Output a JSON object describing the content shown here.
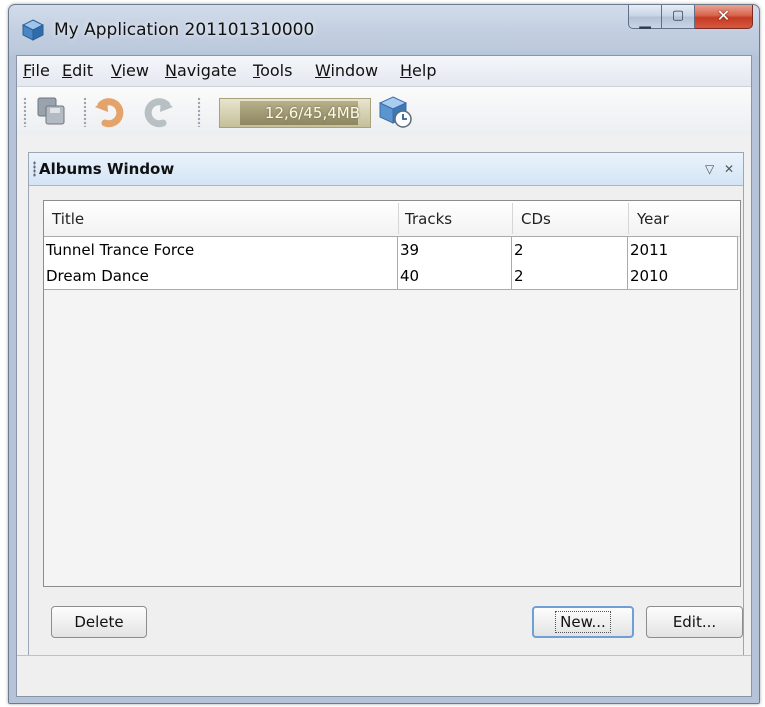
{
  "window": {
    "title": "My Application 201101310000"
  },
  "menu": [
    {
      "mnemonic": "F",
      "rest": "ile"
    },
    {
      "mnemonic": "E",
      "rest": "dit"
    },
    {
      "mnemonic": "V",
      "rest": "iew"
    },
    {
      "mnemonic": "N",
      "rest": "avigate"
    },
    {
      "mnemonic": "T",
      "rest": "ools"
    },
    {
      "mnemonic": "W",
      "rest": "indow"
    },
    {
      "mnemonic": "H",
      "rest": "elp"
    }
  ],
  "toolbar": {
    "memory_label": "12,6/45,4MB",
    "memory_used_fraction": 0.28,
    "icons": [
      "save-all-icon",
      "undo-icon",
      "redo-icon",
      "garbage-collect-icon"
    ]
  },
  "albums_panel": {
    "title": "Albums Window",
    "table": {
      "columns": [
        "Title",
        "Tracks",
        "CDs",
        "Year"
      ],
      "rows": [
        [
          "Tunnel Trance Force",
          "39",
          "2",
          "2011"
        ],
        [
          "Dream Dance",
          "40",
          "2",
          "2010"
        ]
      ]
    },
    "buttons": {
      "delete": "Delete",
      "new": "New...",
      "edit": "Edit..."
    }
  },
  "colors": {
    "panel_tab": "#d4e4f5",
    "close_button": "#c43c23",
    "default_button_border": "#6f9fd6"
  }
}
